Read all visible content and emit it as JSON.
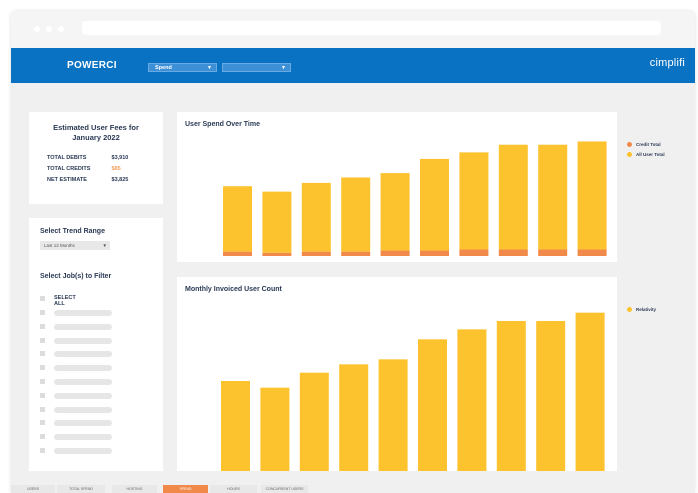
{
  "app": {
    "title": "POWERCI",
    "brand": "cimplifi",
    "dropdown1": "Spend",
    "dropdown2": ""
  },
  "fees": {
    "title_line1": "Estimated User Fees for",
    "title_line2": "January 2022",
    "rows": [
      {
        "label": "TOTAL DEBITS",
        "value": "$3,910"
      },
      {
        "label": "TOTAL CREDITS",
        "value": "$85"
      },
      {
        "label": "NET ESTIMATE",
        "value": "$3,825"
      }
    ]
  },
  "filters": {
    "trend_title": "Select Trend Range",
    "trend_value": "Last 12 Months",
    "jobs_title": "Select Job(s) to Filter",
    "select_all": "SELECT ALL",
    "job_placeholder_count": 11
  },
  "colors": {
    "header": "#0a72c3",
    "bar_yellow": "#fcc32e",
    "bar_orange": "#f0894a",
    "text_dark": "#2b3a55"
  },
  "chart_data": [
    {
      "type": "bar",
      "title": "User Spend Over Time",
      "stacked": true,
      "series": [
        {
          "name": "Credit Total",
          "color": "#f0894a",
          "values": [
            4,
            3,
            4,
            4,
            5,
            5,
            6,
            6,
            6,
            6,
            7
          ]
        },
        {
          "name": "All User Total",
          "color": "#fcc32e",
          "values": [
            60,
            56,
            63,
            68,
            71,
            84,
            89,
            96,
            96,
            99
          ]
        }
      ],
      "ylim": [
        0,
        110
      ],
      "legend": "top-right",
      "grid": false
    },
    {
      "type": "bar",
      "title": "Monthly Invoiced User Count",
      "series": [
        {
          "name": "Relativity",
          "color": "#fcc32e",
          "values": [
            57,
            53,
            62,
            67,
            70,
            82,
            88,
            93,
            93,
            98
          ]
        }
      ],
      "ylim": [
        0,
        105
      ],
      "legend": "top-right",
      "grid": false
    }
  ],
  "tabs": [
    {
      "label": "USERS",
      "active": false
    },
    {
      "label": "TOTAL SPEND",
      "active": false
    },
    {
      "label": "HOSTING",
      "active": false
    },
    {
      "label": "SPEND",
      "active": true
    },
    {
      "label": "HOURS",
      "active": false
    },
    {
      "label": "CONCURRENT USERS",
      "active": false
    }
  ]
}
